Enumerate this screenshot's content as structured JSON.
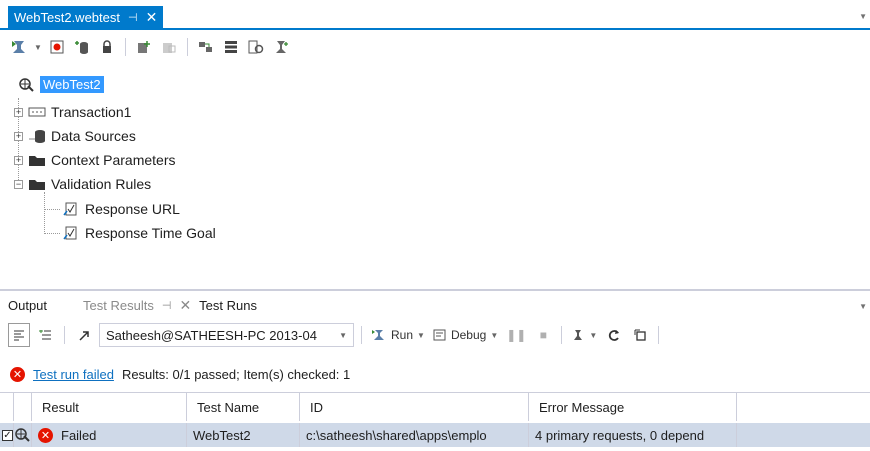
{
  "document_tab": {
    "title": "WebTest2.webtest",
    "pin": "⊣",
    "close": "✕"
  },
  "tree": {
    "root": "WebTest2",
    "items": [
      {
        "label": "Transaction1",
        "expander": "+"
      },
      {
        "label": "Data Sources",
        "expander": "+"
      },
      {
        "label": "Context Parameters",
        "expander": "+"
      },
      {
        "label": "Validation Rules",
        "expander": "−"
      }
    ],
    "children": [
      {
        "label": "Response URL"
      },
      {
        "label": "Response Time Goal"
      }
    ]
  },
  "tool_tabs": {
    "output": "Output",
    "test_results": "Test Results",
    "test_runs": "Test Runs",
    "pin": "⊣",
    "close": "✕"
  },
  "results_toolbar": {
    "run_selector": "Satheesh@SATHEESH-PC 2013-04",
    "run_label": "Run",
    "debug_label": "Debug",
    "dropdown_arrow": "▾"
  },
  "status": {
    "link": "Test run failed",
    "summary": "Results: 0/1 passed;  Item(s) checked: 1"
  },
  "grid": {
    "headers": [
      "Result",
      "Test Name",
      "ID",
      "Error Message"
    ],
    "rows": [
      {
        "checked": "✓",
        "result": "Failed",
        "test_name": "WebTest2",
        "id": "c:\\satheesh\\shared\\apps\\emplo",
        "error_message": "4 primary requests, 0 depend"
      }
    ]
  },
  "colors": {
    "accent": "#007acc",
    "error": "#e51400",
    "link": "#0e70c0",
    "selection": "#3399ff",
    "row_highlight": "#cfd9e8"
  }
}
